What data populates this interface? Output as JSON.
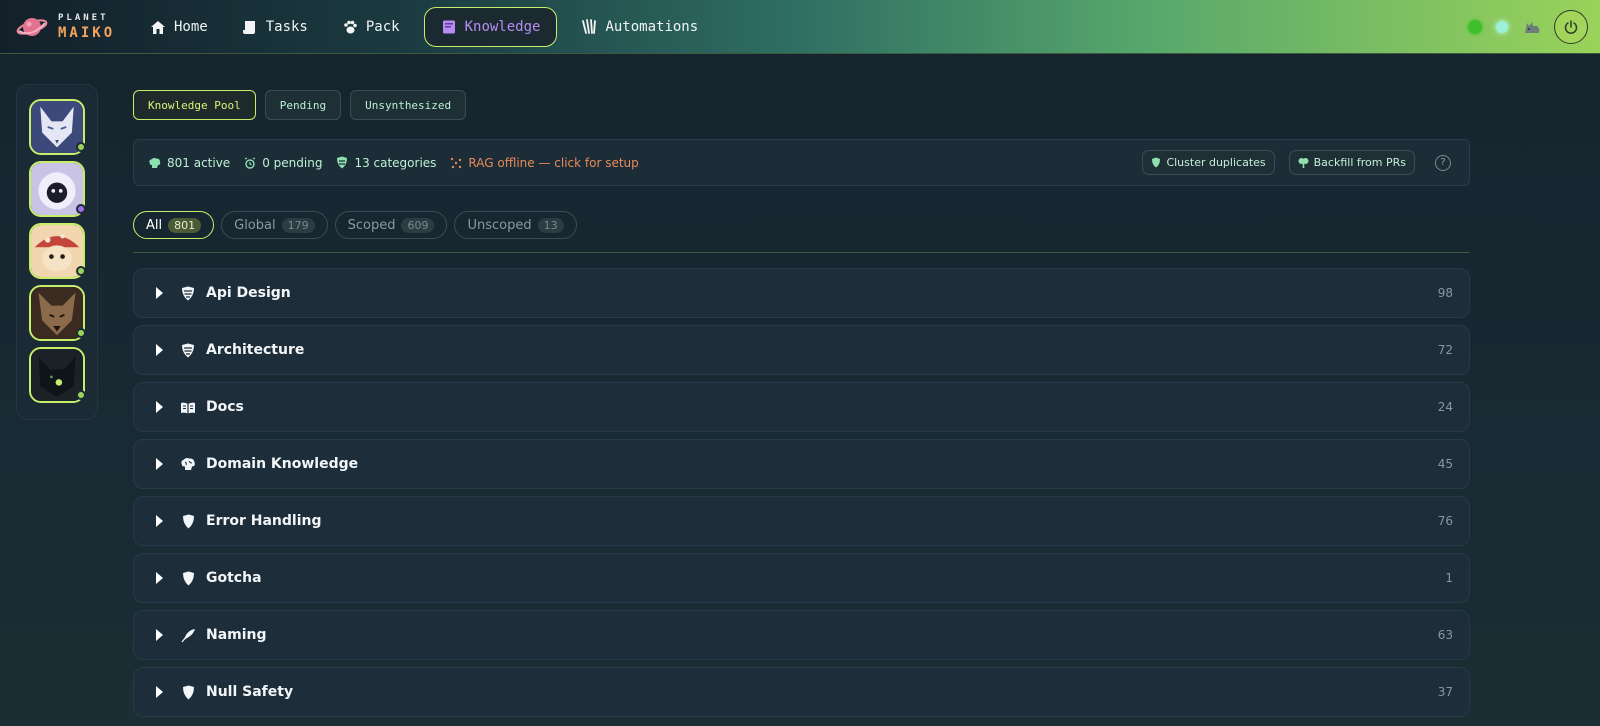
{
  "brand": {
    "top": "PLANET",
    "bottom": "MAIKO"
  },
  "nav": {
    "items": [
      {
        "label": "Home",
        "icon": "house-icon"
      },
      {
        "label": "Tasks",
        "icon": "scroll-icon"
      },
      {
        "label": "Pack",
        "icon": "paw-icon"
      },
      {
        "label": "Knowledge",
        "icon": "book-icon",
        "active": true
      },
      {
        "label": "Automations",
        "icon": "claw-icon"
      }
    ]
  },
  "topbar_right": {
    "status_green": "#3fc02b",
    "status_cyan": "#9af0d8",
    "icons": [
      "cat-icon",
      "power-icon"
    ]
  },
  "tabs": [
    {
      "label": "Knowledge Pool",
      "active": true
    },
    {
      "label": "Pending"
    },
    {
      "label": "Unsynthesized"
    }
  ],
  "stats": {
    "active": "801 active",
    "pending": "0 pending",
    "categories": "13 categories",
    "rag": "RAG offline — click for setup",
    "cluster_button": "Cluster duplicates",
    "backfill_button": "Backfill from PRs",
    "help": "?"
  },
  "filters": [
    {
      "label": "All",
      "count": "801",
      "active": true
    },
    {
      "label": "Global",
      "count": "179"
    },
    {
      "label": "Scoped",
      "count": "609"
    },
    {
      "label": "Unscoped",
      "count": "13"
    }
  ],
  "categories": [
    {
      "name": "Api Design",
      "count": "98",
      "icon": "shield-stripes-icon"
    },
    {
      "name": "Architecture",
      "count": "72",
      "icon": "shield-stripes-icon"
    },
    {
      "name": "Docs",
      "count": "24",
      "icon": "open-book-icon"
    },
    {
      "name": "Domain Knowledge",
      "count": "45",
      "icon": "brain-icon"
    },
    {
      "name": "Error Handling",
      "count": "76",
      "icon": "shield-icon"
    },
    {
      "name": "Gotcha",
      "count": "1",
      "icon": "shield-icon"
    },
    {
      "name": "Naming",
      "count": "63",
      "icon": "quill-icon"
    },
    {
      "name": "Null Safety",
      "count": "37",
      "icon": "shield-icon"
    }
  ],
  "colors": {
    "accent": "#c7ee6a",
    "active_nav_text": "#b78cf2",
    "rag_warning": "#e8895a",
    "brand_orange": "#f5a35a"
  }
}
